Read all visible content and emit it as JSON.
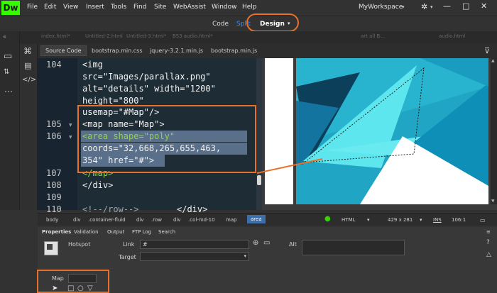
{
  "app": {
    "logo": "Dw",
    "workspace": "MyWorkspace",
    "accent": "#e8702a",
    "brand": "#35fa00"
  },
  "menu": [
    "File",
    "Edit",
    "View",
    "Insert",
    "Tools",
    "Find",
    "Site",
    "WebAssist",
    "Window",
    "Help"
  ],
  "view": {
    "code": "Code",
    "split": "Split",
    "design": "Design"
  },
  "doctabs": [
    "index.html*",
    "Untitled-2.html",
    "Untitled-3.html*",
    "BS3 audio.html*",
    "art all B...",
    "audio.html"
  ],
  "related": [
    "Source Code",
    "bootstrap.min.css",
    "jquery-3.2.1.min.js",
    "bootstrap.min.js"
  ],
  "code": {
    "lines": [
      {
        "num": "104",
        "text": "<img"
      },
      {
        "num": "",
        "text": "src=\"Images/parallax.png\""
      },
      {
        "num": "",
        "text": "alt=\"details\" width=\"1200\""
      },
      {
        "num": "",
        "text": "height=\"800\""
      },
      {
        "num": "",
        "text": "usemap=\"#Map\"/>"
      },
      {
        "num": "105",
        "text": "<map name=\"Map\">"
      },
      {
        "num": "106",
        "text": "<area shape=\"poly\""
      },
      {
        "num": "",
        "text": "coords=\"32,668,265,655,463,"
      },
      {
        "num": "",
        "text": "354\" href=\"#\">"
      },
      {
        "num": "107",
        "text": "</map>"
      },
      {
        "num": "108",
        "text": "</div>"
      },
      {
        "num": "109",
        "text": ""
      },
      {
        "num": "110",
        "text": "<!--/row-->"
      }
    ],
    "line110_suffix": "</div>"
  },
  "tagbar": {
    "items": [
      "body",
      "div",
      ".container-fluid",
      "div",
      ".row",
      "div",
      ".col-md-10",
      "map",
      "area"
    ],
    "doctype": "HTML",
    "size": "429 x 281",
    "mode": "INS",
    "pos": "106:1"
  },
  "props": {
    "tabs": [
      "Properties",
      "Validation",
      "Output",
      "FTP Log",
      "Search"
    ],
    "hotspot": "Hotspot",
    "link_label": "Link",
    "link_value": "#",
    "target_label": "Target",
    "alt_label": "Alt",
    "map_label": "Map",
    "map_value": ""
  }
}
